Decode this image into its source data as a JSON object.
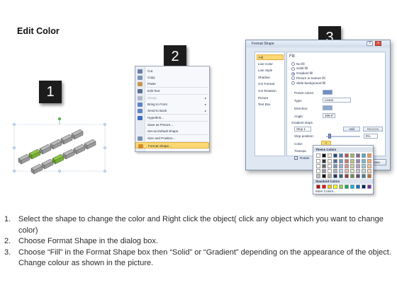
{
  "title": "Edit Color",
  "steps": [
    "1",
    "2",
    "3"
  ],
  "context_menu": {
    "items": [
      {
        "label": "Cut",
        "icon": "scissors-icon",
        "icon_color": "#6b7fa8"
      },
      {
        "label": "Copy",
        "icon": "copy-icon",
        "icon_color": "#7b93bb"
      },
      {
        "label": "Paste",
        "icon": "paste-icon",
        "icon_color": "#c49a4a"
      },
      {
        "label": "Edit Text",
        "icon": "edit-text-icon",
        "icon_color": "#5b6f94"
      },
      {
        "label": "Group",
        "icon": "group-icon",
        "icon_color": "#b0b8c8",
        "disabled": true,
        "submenu": true
      },
      {
        "label": "Bring to Front",
        "icon": "bring-front-icon",
        "icon_color": "#5a82c4",
        "submenu": true
      },
      {
        "label": "Send to Back",
        "icon": "send-back-icon",
        "icon_color": "#5a82c4",
        "submenu": true
      },
      {
        "label": "Hyperlink...",
        "icon": "hyperlink-icon",
        "icon_color": "#3b6fc2"
      },
      {
        "label": "Save as Picture...",
        "icon": "",
        "icon_color": ""
      },
      {
        "label": "Set as Default Shape",
        "icon": "",
        "icon_color": ""
      },
      {
        "label": "Size and Position...",
        "icon": "size-icon",
        "icon_color": "#7a8eb2"
      },
      {
        "label": "Format Shape...",
        "icon": "format-shape-icon",
        "icon_color": "#d08a2a",
        "highlighted": true
      }
    ]
  },
  "dialog": {
    "title": "Format Shape",
    "nav": [
      "Fill",
      "Line Color",
      "Line Style",
      "Shadow",
      "3-D Format",
      "3-D Rotation",
      "Picture",
      "Text Box"
    ],
    "section": "Fill",
    "fill_options": [
      "No fill",
      "Solid fill",
      "Gradient fill",
      "Picture or texture fill",
      "Slide background fill"
    ],
    "selected_fill": "Gradient fill",
    "preset_colors_label": "Preset colors:",
    "type_label": "Type:",
    "type_value": "Linear",
    "direction_label": "Direction:",
    "angle_label": "Angle:",
    "angle_value": "359.9°",
    "gradient_stops_label": "Gradient stops",
    "stop_value": "Stop 1",
    "add_label": "Add",
    "remove_label": "Remove",
    "stop_position_label": "Stop position:",
    "stop_position_value": "0%",
    "color_label": "Color:",
    "transparency_label": "Transpa",
    "rotate_label": "Rotate",
    "close_label": "Close"
  },
  "palette": {
    "theme_header": "Theme Colors",
    "standard_header": "Standard Colors",
    "more_label": "More Colors...",
    "theme_top": [
      "#ffffff",
      "#000000",
      "#eeece1",
      "#1f497d",
      "#4f81bd",
      "#c0504d",
      "#9bbb59",
      "#8064a2",
      "#4bacc6",
      "#f79646"
    ],
    "standard": [
      "#c00000",
      "#ff0000",
      "#ffc000",
      "#ffff00",
      "#92d050",
      "#00b050",
      "#00b0f0",
      "#0070c0",
      "#002060",
      "#7030a0"
    ]
  },
  "instructions": [
    {
      "num": "1.",
      "text": "Select the shape to change the color and Right click the object( click any object which you want to change color)"
    },
    {
      "num": "2.",
      "text": "Choose Format Shape in the dialog box."
    },
    {
      "num": "3.",
      "text": "Choose “Fill” in the Format Shape box then “Solid” or “Gradient” depending on the appearance of the object. Change colour as shown in the picture."
    }
  ],
  "colors": {
    "accent_green": "#8cc63f",
    "arrow_gray": "#8a8a8a",
    "menu_highlight": "#fbd874"
  }
}
